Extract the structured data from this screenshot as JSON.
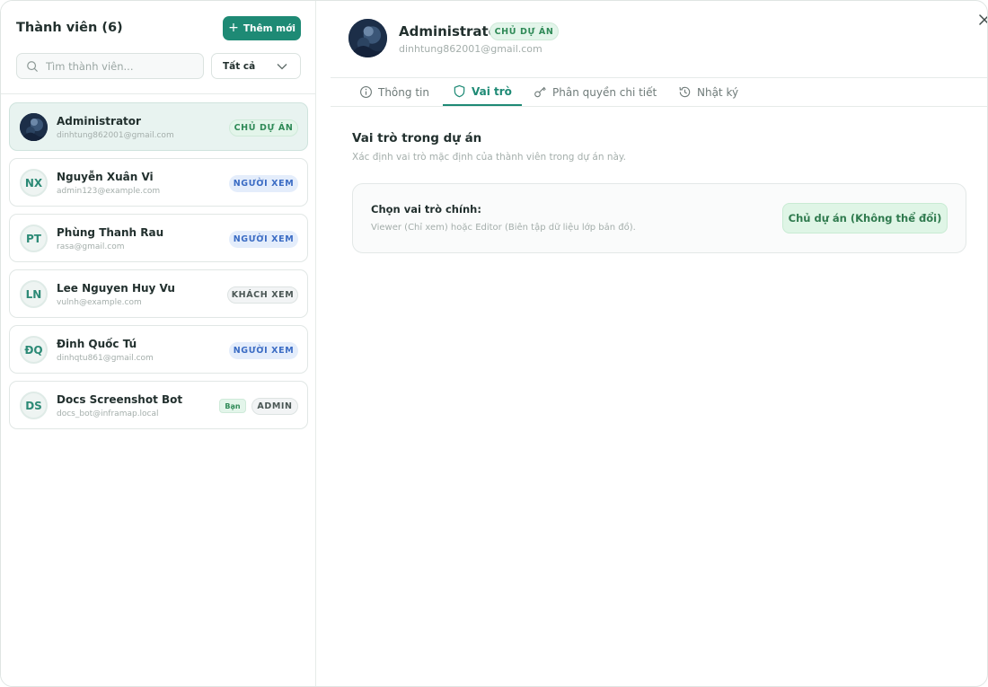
{
  "left_panel": {
    "title": "Thành viên (6)",
    "add_button": "Thêm mới",
    "search_placeholder": "Tìm thành viên...",
    "filter_value": "Tất cả"
  },
  "members": [
    {
      "name": "Administrator",
      "email": "dinhtung862001@gmail.com",
      "initials": "",
      "role": "CHỦ DỰ ÁN",
      "you": ""
    },
    {
      "name": "Nguyễn Xuân Vi",
      "email": "admin123@example.com",
      "initials": "NX",
      "role": "NGƯỜI XEM",
      "you": ""
    },
    {
      "name": "Phùng Thanh Rau",
      "email": "rasa@gmail.com",
      "initials": "PT",
      "role": "NGƯỜI XEM",
      "you": ""
    },
    {
      "name": "Lee Nguyen Huy Vu",
      "email": "vulnh@example.com",
      "initials": "LN",
      "role": "KHÁCH XEM",
      "you": ""
    },
    {
      "name": "Đinh Quốc Tú",
      "email": "dinhqtu861@gmail.com",
      "initials": "ĐQ",
      "role": "NGƯỜI XEM",
      "you": ""
    },
    {
      "name": "Docs Screenshot Bot",
      "email": "docs_bot@inframap.local",
      "initials": "DS",
      "role": "ADMIN",
      "you": "Bạn"
    }
  ],
  "detail": {
    "name": "Administrator",
    "badge": "CHỦ DỰ ÁN",
    "email": "dinhtung862001@gmail.com",
    "tabs": [
      "Thông tin",
      "Vai trò",
      "Phân quyền chi tiết",
      "Nhật ký"
    ],
    "active_tab": "Vai trò",
    "section_title": "Vai trò trong dự án",
    "section_desc": "Xác định vai trò mặc định của thành viên trong dự án này.",
    "card_label": "Chọn vai trò chính:",
    "card_desc": "Viewer (Chỉ xem) hoặc Editor (Biên tập dữ liệu lớp bản đồ).",
    "card_button": "Chủ dự án (Không thể đổi)"
  },
  "colors": {
    "accent": "#1e8a75",
    "owner_badge": "#2f8a57",
    "viewer_badge": "#3b6cc4"
  },
  "icons": {
    "search": "search-icon",
    "filter_chevron": "chevron-down-icon",
    "close": "close-icon",
    "tab_info": "info-icon",
    "tab_role": "shield-icon",
    "tab_permissions": "key-icon",
    "tab_log": "history-icon"
  }
}
